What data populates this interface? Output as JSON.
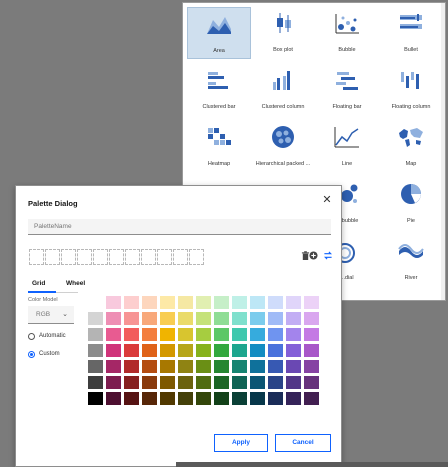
{
  "chart_gallery": {
    "tiles": [
      {
        "label": "Area",
        "icon": "area-chart-icon",
        "selected": true
      },
      {
        "label": "Box plot",
        "icon": "box-plot-icon"
      },
      {
        "label": "Bubble",
        "icon": "bubble-chart-icon"
      },
      {
        "label": "Bullet",
        "icon": "bullet-chart-icon"
      },
      {
        "label": "Clustered bar",
        "icon": "clustered-bar-icon"
      },
      {
        "label": "Clustered column",
        "icon": "clustered-column-icon"
      },
      {
        "label": "Floating bar",
        "icon": "floating-bar-icon"
      },
      {
        "label": "Floating column",
        "icon": "floating-column-icon"
      },
      {
        "label": "Heatmap",
        "icon": "heatmap-icon"
      },
      {
        "label": "Hierarchical packed ...",
        "icon": "packed-bubble-icon"
      },
      {
        "label": "Line",
        "icon": "line-chart-icon"
      },
      {
        "label": "Map",
        "icon": "map-icon"
      },
      {
        "label": "",
        "icon": "table-icon"
      },
      {
        "label": "",
        "icon": "scatter-icon"
      },
      {
        "label": "... bubble",
        "icon": "packed-circles-icon"
      },
      {
        "label": "Pie",
        "icon": "pie-chart-icon"
      },
      {
        "label": "",
        "icon": "blank-icon"
      },
      {
        "label": "",
        "icon": "blank-icon"
      },
      {
        "label": "...dial",
        "icon": "radial-icon"
      },
      {
        "label": "River",
        "icon": "river-icon"
      },
      {
        "label": "",
        "icon": "blank-icon"
      },
      {
        "label": "",
        "icon": "blank-icon"
      },
      {
        "label": "",
        "icon": "radial-partial-icon"
      },
      {
        "label": "",
        "icon": "spline-icon"
      }
    ]
  },
  "dialog": {
    "title": "Palette Dialog",
    "close_icon": "close-icon",
    "name_input": {
      "value": "",
      "placeholder": "PaletteName"
    },
    "slot_count": 11,
    "icons": {
      "trash": "trash-icon",
      "add": "add-circle-icon",
      "swap": "swap-icon"
    },
    "tabs": [
      {
        "label": "Grid",
        "active": true
      },
      {
        "label": "Wheel",
        "active": false
      }
    ],
    "color_model_label": "Color Model",
    "color_model_value": "RGB",
    "radios": [
      {
        "label": "Automatic",
        "checked": false
      },
      {
        "label": "Custom",
        "checked": true
      }
    ],
    "apply_label": "Apply",
    "cancel_label": "Cancel",
    "palette_columns": [
      [
        "#ffffff",
        "#d4d4d4",
        "#b4b4b4",
        "#8c8c8c",
        "#666666",
        "#3d3d3d",
        "#000000"
      ],
      [
        "#f8c9dd",
        "#ee8eb4",
        "#e85b91",
        "#d0347a",
        "#a52766",
        "#7d1c4f",
        "#4d0f30"
      ],
      [
        "#fdcece",
        "#f79494",
        "#f25c5c",
        "#da3b3b",
        "#b12a2a",
        "#861f1f",
        "#561313"
      ],
      [
        "#fdd6bd",
        "#f8a87a",
        "#f37e3e",
        "#df6218",
        "#b44c10",
        "#893a0c",
        "#572607"
      ],
      [
        "#fde9a6",
        "#f8cd52",
        "#f0b400",
        "#d39800",
        "#a87800",
        "#7e5900",
        "#513900"
      ],
      [
        "#f5e8a3",
        "#eadb6a",
        "#d8c52f",
        "#b6a619",
        "#8f8313",
        "#6b620e",
        "#444009"
      ],
      [
        "#e1efb1",
        "#c5e27a",
        "#a6cd40",
        "#86b21d",
        "#6a8f15",
        "#506c10",
        "#33460a"
      ],
      [
        "#c6efc8",
        "#8fdd95",
        "#5cc766",
        "#33a83e",
        "#268630",
        "#1c6524",
        "#124118"
      ],
      [
        "#bff0e7",
        "#7fe0cd",
        "#3fc8ad",
        "#1da68e",
        "#168471",
        "#106455",
        "#0a4036"
      ],
      [
        "#bde7f6",
        "#7bcced",
        "#36abdd",
        "#148dc2",
        "#0f719b",
        "#0b5574",
        "#07374a"
      ],
      [
        "#cfdcfb",
        "#a0bbf7",
        "#6f94f0",
        "#4a72dc",
        "#3759b3",
        "#294387",
        "#1a2c58"
      ],
      [
        "#e0d5fa",
        "#c2adf4",
        "#a384ec",
        "#8460d8",
        "#6a48b3",
        "#513687",
        "#352359"
      ],
      [
        "#ecd2f7",
        "#d9a6ef",
        "#c47ae4",
        "#a857c9",
        "#8642a3",
        "#66317c",
        "#421f51"
      ]
    ]
  }
}
